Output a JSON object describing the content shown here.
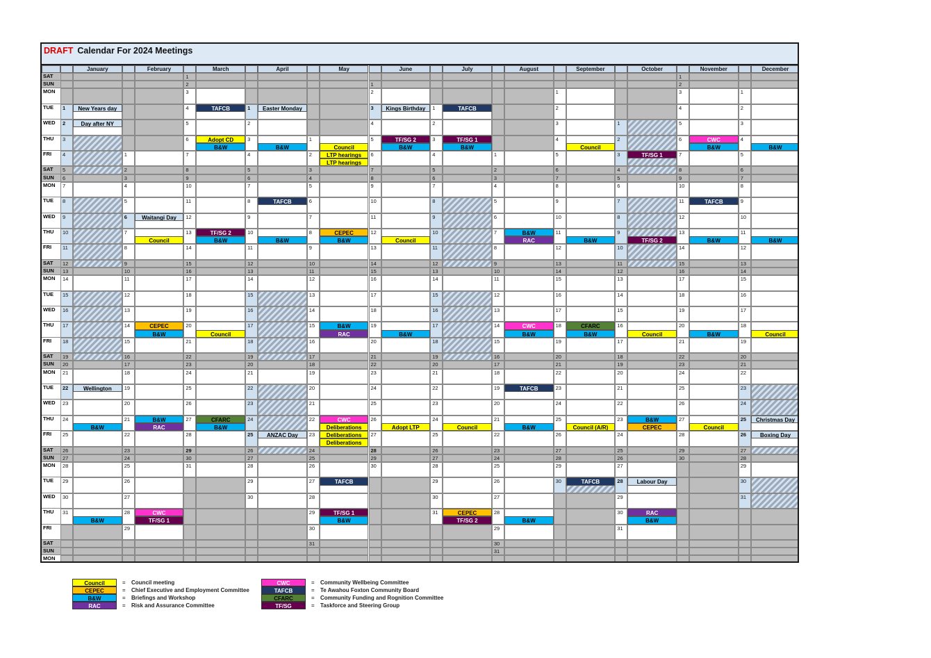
{
  "title": {
    "draft": "DRAFT",
    "rest": "Calendar For 2024 Meetings"
  },
  "months": [
    "January",
    "February",
    "March",
    "April",
    "May",
    "June",
    "July",
    "August",
    "September",
    "October",
    "November",
    "December"
  ],
  "first_dow": [
    1,
    4,
    5,
    1,
    3,
    6,
    1,
    4,
    0,
    2,
    5,
    0
  ],
  "days_in_month": [
    31,
    29,
    31,
    30,
    31,
    30,
    31,
    31,
    30,
    31,
    30,
    31
  ],
  "dow_labels": [
    "MON",
    "TUE",
    "WED",
    "THU",
    "FRI",
    "SAT",
    "SUN"
  ],
  "event_colors": {
    "Council": {
      "bg": "#ffff00",
      "fg": "#000000"
    },
    "CEPEC": {
      "bg": "#ffc000",
      "fg": "#000000"
    },
    "B&W": {
      "bg": "#00b0f0",
      "fg": "#000000"
    },
    "RAC": {
      "bg": "#7030a0",
      "fg": "#ffffff"
    },
    "CWC": {
      "bg": "#ff33cc",
      "fg": "#ffffff"
    },
    "TAFCB": {
      "bg": "#1f3864",
      "fg": "#ffffff"
    },
    "CFARC": {
      "bg": "#548235",
      "fg": "#000000"
    },
    "TF/SG": {
      "bg": "#66004d",
      "fg": "#ffffff"
    },
    "TF/SG 1": {
      "bg": "#66004d",
      "fg": "#ffffff"
    },
    "TF/SG 2": {
      "bg": "#66004d",
      "fg": "#ffffff"
    },
    "Adopt CD": {
      "bg": "#ffff00",
      "fg": "#000000"
    },
    "Adopt LTP": {
      "bg": "#ffff00",
      "fg": "#000000"
    },
    "LTP hearings": {
      "bg": "#ffff00",
      "fg": "#000000"
    },
    "Deliberations": {
      "bg": "#ffff00",
      "fg": "#000000"
    },
    "Council (A/R)": {
      "bg": "#ffff00",
      "fg": "#000000"
    },
    "holiday": {
      "bg": "#cfe0f0",
      "fg": "#000000"
    }
  },
  "holidays": [
    {
      "m": 0,
      "d": 1,
      "label": "New Years day"
    },
    {
      "m": 0,
      "d": 2,
      "label": "Day after NY"
    },
    {
      "m": 0,
      "d": 22,
      "label": "Wellington"
    },
    {
      "m": 1,
      "d": 6,
      "label": "Waitangi Day"
    },
    {
      "m": 2,
      "d": 29,
      "label": "Good Friday"
    },
    {
      "m": 3,
      "d": 1,
      "label": "Easter Monday"
    },
    {
      "m": 3,
      "d": 25,
      "label": "ANZAC Day"
    },
    {
      "m": 5,
      "d": 3,
      "label": "Kings Birthday"
    },
    {
      "m": 5,
      "d": 28,
      "label": "Matariki"
    },
    {
      "m": 9,
      "d": 28,
      "label": "Labour Day"
    },
    {
      "m": 11,
      "d": 25,
      "label": "Christmas Day"
    },
    {
      "m": 11,
      "d": 26,
      "label": "Boxing Day"
    }
  ],
  "events": [
    {
      "m": 0,
      "d": 24,
      "s": 1,
      "label": "B&W"
    },
    {
      "m": 0,
      "d": 31,
      "s": 1,
      "label": "B&W"
    },
    {
      "m": 1,
      "d": 7,
      "s": 1,
      "label": "Council"
    },
    {
      "m": 1,
      "d": 14,
      "s": 0,
      "label": "CEPEC"
    },
    {
      "m": 1,
      "d": 14,
      "s": 1,
      "label": "B&W"
    },
    {
      "m": 1,
      "d": 21,
      "s": 0,
      "label": "B&W"
    },
    {
      "m": 1,
      "d": 21,
      "s": 1,
      "label": "RAC"
    },
    {
      "m": 1,
      "d": 28,
      "s": 0,
      "label": "CWC"
    },
    {
      "m": 1,
      "d": 28,
      "s": 1,
      "label": "TF/SG 1"
    },
    {
      "m": 2,
      "d": 4,
      "s": 0,
      "label": "TAFCB"
    },
    {
      "m": 2,
      "d": 6,
      "s": 0,
      "label": "Adopt CD"
    },
    {
      "m": 2,
      "d": 6,
      "s": 1,
      "label": "B&W"
    },
    {
      "m": 2,
      "d": 13,
      "s": 0,
      "label": "TF/SG 2"
    },
    {
      "m": 2,
      "d": 13,
      "s": 1,
      "label": "B&W"
    },
    {
      "m": 2,
      "d": 20,
      "s": 1,
      "label": "Council"
    },
    {
      "m": 2,
      "d": 27,
      "s": 0,
      "label": "CFARC"
    },
    {
      "m": 2,
      "d": 27,
      "s": 1,
      "label": "B&W"
    },
    {
      "m": 3,
      "d": 3,
      "s": 1,
      "label": "B&W"
    },
    {
      "m": 3,
      "d": 8,
      "s": 0,
      "label": "TAFCB"
    },
    {
      "m": 3,
      "d": 10,
      "s": 1,
      "label": "B&W"
    },
    {
      "m": 4,
      "d": 1,
      "s": 1,
      "label": "Council"
    },
    {
      "m": 4,
      "d": 2,
      "s": 0,
      "label": "LTP hearings"
    },
    {
      "m": 4,
      "d": 2,
      "s": 1,
      "label": "LTP hearings"
    },
    {
      "m": 4,
      "d": 3,
      "s": 0,
      "label": "LTP hearings"
    },
    {
      "m": 4,
      "d": 3,
      "s": 1,
      "label": "LTP hearings"
    },
    {
      "m": 4,
      "d": 8,
      "s": 0,
      "label": "CEPEC"
    },
    {
      "m": 4,
      "d": 8,
      "s": 1,
      "label": "B&W"
    },
    {
      "m": 4,
      "d": 15,
      "s": 0,
      "label": "B&W"
    },
    {
      "m": 4,
      "d": 15,
      "s": 1,
      "label": "RAC"
    },
    {
      "m": 4,
      "d": 22,
      "s": 0,
      "label": "CWC"
    },
    {
      "m": 4,
      "d": 22,
      "s": 1,
      "label": "Deliberations"
    },
    {
      "m": 4,
      "d": 23,
      "s": 0,
      "label": "Deliberations"
    },
    {
      "m": 4,
      "d": 23,
      "s": 1,
      "label": "Deliberations"
    },
    {
      "m": 4,
      "d": 27,
      "s": 0,
      "label": "TAFCB"
    },
    {
      "m": 4,
      "d": 29,
      "s": 0,
      "label": "TF/SG 1"
    },
    {
      "m": 4,
      "d": 29,
      "s": 1,
      "label": "B&W"
    },
    {
      "m": 5,
      "d": 5,
      "s": 0,
      "label": "TF/SG 2"
    },
    {
      "m": 5,
      "d": 5,
      "s": 1,
      "label": "B&W"
    },
    {
      "m": 5,
      "d": 12,
      "s": 1,
      "label": "Council"
    },
    {
      "m": 5,
      "d": 19,
      "s": 1,
      "label": "B&W"
    },
    {
      "m": 5,
      "d": 26,
      "s": 1,
      "label": "Adopt LTP"
    },
    {
      "m": 6,
      "d": 1,
      "s": 0,
      "label": "TAFCB"
    },
    {
      "m": 6,
      "d": 3,
      "s": 0,
      "label": "TF/SG 1"
    },
    {
      "m": 6,
      "d": 3,
      "s": 1,
      "label": "B&W"
    },
    {
      "m": 6,
      "d": 24,
      "s": 1,
      "label": "Council"
    },
    {
      "m": 6,
      "d": 31,
      "s": 0,
      "label": "CEPEC"
    },
    {
      "m": 6,
      "d": 31,
      "s": 1,
      "label": "TF/SG 2"
    },
    {
      "m": 7,
      "d": 7,
      "s": 0,
      "label": "B&W"
    },
    {
      "m": 7,
      "d": 7,
      "s": 1,
      "label": "RAC"
    },
    {
      "m": 7,
      "d": 14,
      "s": 0,
      "label": "CWC"
    },
    {
      "m": 7,
      "d": 14,
      "s": 1,
      "label": "B&W"
    },
    {
      "m": 7,
      "d": 19,
      "s": 0,
      "label": "TAFCB"
    },
    {
      "m": 7,
      "d": 21,
      "s": 1,
      "label": "B&W"
    },
    {
      "m": 7,
      "d": 28,
      "s": 1,
      "label": "B&W"
    },
    {
      "m": 8,
      "d": 4,
      "s": 1,
      "label": "Council"
    },
    {
      "m": 8,
      "d": 11,
      "s": 1,
      "label": "B&W"
    },
    {
      "m": 8,
      "d": 18,
      "s": 0,
      "label": "CFARC"
    },
    {
      "m": 8,
      "d": 18,
      "s": 1,
      "label": "B&W"
    },
    {
      "m": 8,
      "d": 25,
      "s": 1,
      "label": "Council (A/R)"
    },
    {
      "m": 8,
      "d": 30,
      "s": 0,
      "label": "TAFCB"
    },
    {
      "m": 9,
      "d": 3,
      "s": 0,
      "label": "TF/SG 1"
    },
    {
      "m": 9,
      "d": 9,
      "s": 1,
      "label": "TF/SG 2"
    },
    {
      "m": 9,
      "d": 16,
      "s": 1,
      "label": "Council"
    },
    {
      "m": 9,
      "d": 23,
      "s": 0,
      "label": "B&W"
    },
    {
      "m": 9,
      "d": 23,
      "s": 1,
      "label": "CEPEC"
    },
    {
      "m": 9,
      "d": 30,
      "s": 0,
      "label": "RAC"
    },
    {
      "m": 9,
      "d": 30,
      "s": 1,
      "label": "B&W"
    },
    {
      "m": 10,
      "d": 6,
      "s": 0,
      "label": "CWC"
    },
    {
      "m": 10,
      "d": 6,
      "s": 1,
      "label": "B&W"
    },
    {
      "m": 10,
      "d": 11,
      "s": 0,
      "label": "TAFCB"
    },
    {
      "m": 10,
      "d": 13,
      "s": 1,
      "label": "B&W"
    },
    {
      "m": 10,
      "d": 20,
      "s": 1,
      "label": "B&W"
    },
    {
      "m": 10,
      "d": 27,
      "s": 1,
      "label": "Council"
    },
    {
      "m": 11,
      "d": 4,
      "s": 1,
      "label": "B&W"
    },
    {
      "m": 11,
      "d": 11,
      "s": 1,
      "label": "B&W"
    },
    {
      "m": 11,
      "d": 18,
      "s": 1,
      "label": "Council"
    }
  ],
  "hatched": [
    [
      0,
      3
    ],
    [
      0,
      4
    ],
    [
      0,
      5
    ],
    [
      0,
      8
    ],
    [
      0,
      9
    ],
    [
      0,
      10
    ],
    [
      0,
      11
    ],
    [
      0,
      12
    ],
    [
      0,
      15
    ],
    [
      0,
      16
    ],
    [
      0,
      17
    ],
    [
      0,
      18
    ],
    [
      0,
      19
    ],
    [
      3,
      15
    ],
    [
      3,
      16
    ],
    [
      3,
      17
    ],
    [
      3,
      18
    ],
    [
      3,
      19
    ],
    [
      3,
      22
    ],
    [
      3,
      23
    ],
    [
      3,
      24
    ],
    [
      3,
      26
    ],
    [
      6,
      8
    ],
    [
      6,
      9
    ],
    [
      6,
      10
    ],
    [
      6,
      11
    ],
    [
      6,
      12
    ],
    [
      6,
      15
    ],
    [
      6,
      16
    ],
    [
      6,
      17
    ],
    [
      6,
      18
    ],
    [
      6,
      19
    ],
    [
      8,
      30
    ],
    [
      9,
      1
    ],
    [
      9,
      2
    ],
    [
      9,
      3
    ],
    [
      9,
      4
    ],
    [
      9,
      7
    ],
    [
      9,
      8
    ],
    [
      9,
      9
    ],
    [
      9,
      10
    ],
    [
      9,
      11
    ],
    [
      11,
      23
    ],
    [
      11,
      24
    ],
    [
      11,
      27
    ],
    [
      11,
      30
    ],
    [
      11,
      31
    ]
  ],
  "legend": [
    {
      "label": "Council",
      "desc": "Council meeting"
    },
    {
      "label": "CEPEC",
      "desc": "Chief Executive and Employment Committee"
    },
    {
      "label": "B&W",
      "desc": "Briefings and Workshop"
    },
    {
      "label": "RAC",
      "desc": "Risk and Assurance Committee"
    },
    {
      "label": "CWC",
      "desc": "Community Wellbeing Committee"
    },
    {
      "label": "TAFCB",
      "desc": "Te Awahou Foxton Community Board"
    },
    {
      "label": "CFARC",
      "desc": "Community Funding and Rognition Committee"
    },
    {
      "label": "TF/SG",
      "desc": "Taskforce and Steering Group"
    }
  ],
  "legend_eq": "="
}
